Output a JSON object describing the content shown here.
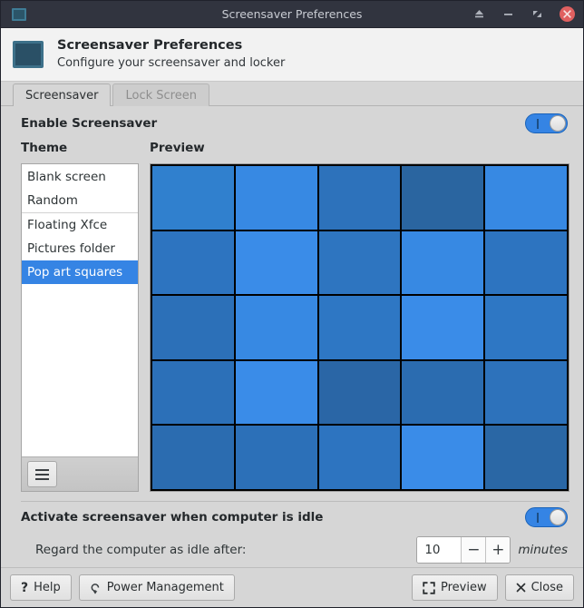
{
  "window": {
    "title": "Screensaver Preferences",
    "app_icon": "monitor-icon",
    "buttons": {
      "shade": "shade-icon",
      "minimize": "minimize-icon",
      "maximize": "maximize-icon",
      "close": "close-icon"
    }
  },
  "header": {
    "icon": "screensaver-monitor-icon",
    "title": "Screensaver Preferences",
    "subtitle": "Configure your screensaver and locker"
  },
  "tabs": [
    {
      "label": "Screensaver",
      "active": true
    },
    {
      "label": "Lock Screen",
      "active": false
    }
  ],
  "enable_row": {
    "label": "Enable Screensaver",
    "toggle_on": true
  },
  "theme": {
    "section_label": "Theme",
    "items": [
      {
        "label": "Blank screen",
        "selected": false,
        "separator_above": false
      },
      {
        "label": "Random",
        "selected": false,
        "separator_above": false
      },
      {
        "label": "Floating Xfce",
        "selected": false,
        "separator_above": true
      },
      {
        "label": "Pictures folder",
        "selected": false,
        "separator_above": false
      },
      {
        "label": "Pop art squares",
        "selected": true,
        "separator_above": false
      }
    ],
    "menu_button": "hamburger-menu-icon"
  },
  "preview": {
    "section_label": "Preview",
    "background": "#000000",
    "grid": {
      "rows": 5,
      "cols": 5,
      "colors": [
        [
          "#3080ce",
          "#3789e3",
          "#2d72bb",
          "#2a65a0",
          "#3789e3"
        ],
        [
          "#2d74c0",
          "#3a8ce8",
          "#2e75c0",
          "#3789e3",
          "#2d74c0"
        ],
        [
          "#2c70b8",
          "#3789e3",
          "#2e77c4",
          "#3a8ce8",
          "#2e77c4"
        ],
        [
          "#2c70b8",
          "#3a8ce8",
          "#2a66a6",
          "#2b6cb0",
          "#2d72bb"
        ],
        [
          "#2b6cb0",
          "#2c70b8",
          "#2d74c0",
          "#3a8ce8",
          "#2a67a5"
        ]
      ]
    }
  },
  "idle": {
    "label": "Activate screensaver when computer is idle",
    "toggle_on": true,
    "delay_label": "Regard the computer as idle after:",
    "delay_value": "10",
    "delay_decrement": "−",
    "delay_increment": "+",
    "delay_units": "minutes"
  },
  "actions": {
    "help": {
      "label": "Help",
      "icon": "question-mark-icon"
    },
    "power_management": {
      "label": "Power Management",
      "icon": "power-loop-icon"
    },
    "preview": {
      "label": "Preview",
      "icon": "fullscreen-corners-icon"
    },
    "close": {
      "label": "Close",
      "icon": "x-close-icon"
    }
  },
  "colors": {
    "accent": "#3584e4",
    "titlebar": "#31343f",
    "window_bg": "#d6d6d6",
    "close_button": "#e06060"
  }
}
